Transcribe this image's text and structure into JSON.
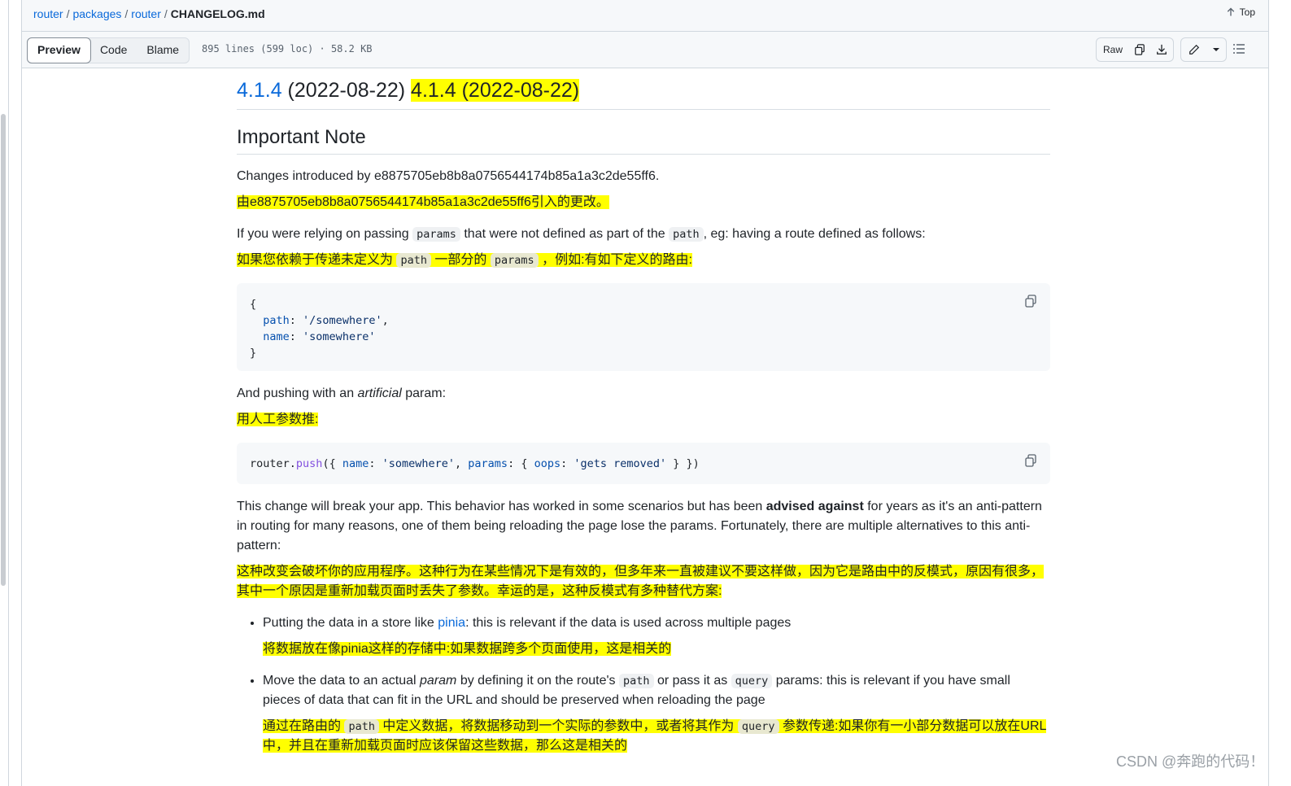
{
  "breadcrumb": {
    "parts": [
      "router",
      "packages",
      "router"
    ],
    "file": "CHANGELOG.md",
    "sep": "/"
  },
  "top_link": "Top",
  "toolbar": {
    "tabs": [
      "Preview",
      "Code",
      "Blame"
    ],
    "file_info": "895 lines (599 loc) · 58.2 KB",
    "raw_label": "Raw"
  },
  "doc": {
    "version_link": "4.1.4",
    "version_date": " (2022-08-22) ",
    "version_hl": "4.1.4 (2022-08-22)",
    "heading2": "Important Note",
    "p1": "Changes introduced by e8875705eb8b8a0756544174b85a1a3c2de55ff6.",
    "p1_cn": "由e8875705eb8b8a0756544174b85a1a3c2de55ff6引入的更改。",
    "p2": {
      "a": "If you were relying on passing ",
      "code1": "params",
      "b": " that were not defined as part of the ",
      "code2": "path",
      "c": ", eg: having a route defined as follows:"
    },
    "p2_cn": {
      "a": "如果您依赖于传递未定义为 ",
      "code1": "path",
      "b": " 一部分的 ",
      "code2": "params",
      "c": " ，例如:有如下定义的路由:"
    },
    "code1": {
      "l1": "{",
      "k1": "path",
      "v1": "'/somewhere'",
      "k2": "name",
      "v2": "'somewhere'",
      "l4": "}"
    },
    "p3": {
      "a": "And pushing with an ",
      "em": "artificial",
      "b": " param:"
    },
    "p3_cn": "用人工参数推:",
    "code2": {
      "obj": "router",
      "fn": "push",
      "k1": "name",
      "v1": "'somewhere'",
      "k2": "params",
      "k3": "oops",
      "v3": "'gets removed'"
    },
    "p4": {
      "a": "This change will break your app. This behavior has worked in some scenarios but has been ",
      "strong": "advised against",
      "b": " for years as it's an anti-pattern in routing for many reasons, one of them being reloading the page lose the params. Fortunately, there are multiple alternatives to this anti-pattern:"
    },
    "p4_cn": "这种改变会破坏你的应用程序。这种行为在某些情况下是有效的，但多年来一直被建议不要这样做，因为它是路由中的反模式，原因有很多，其中一个原因是重新加载页面时丢失了参数。幸运的是，这种反模式有多种替代方案:",
    "li1": {
      "a": "Putting the data in a store like ",
      "link": "pinia",
      "b": ": this is relevant if the data is used across multiple pages"
    },
    "li1_cn": "将数据放在像pinia这样的存储中:如果数据跨多个页面使用，这是相关的",
    "li2": {
      "a": "Move the data to an actual ",
      "em": "param",
      "b": " by defining it on the route's ",
      "code1": "path",
      "c": " or pass it as ",
      "code2": "query",
      "d": " params: this is relevant if you have small pieces of data that can fit in the URL and should be preserved when reloading the page"
    },
    "li2_cn": {
      "a": "通过在路由的 ",
      "code1": "path",
      "b": " 中定义数据，将数据移动到一个实际的参数中，或者将其作为 ",
      "code2": "query",
      "c": " 参数传递:如果你有一小部分数据可以放在URL中，并且在重新加载页面时应该保留这些数据，那么这是相关的"
    }
  },
  "watermark": "CSDN @奔跑的代码！",
  "icons": [
    "arrow-up-icon",
    "copy-icon",
    "download-icon",
    "pencil-icon",
    "caret-down-icon",
    "list-icon"
  ]
}
